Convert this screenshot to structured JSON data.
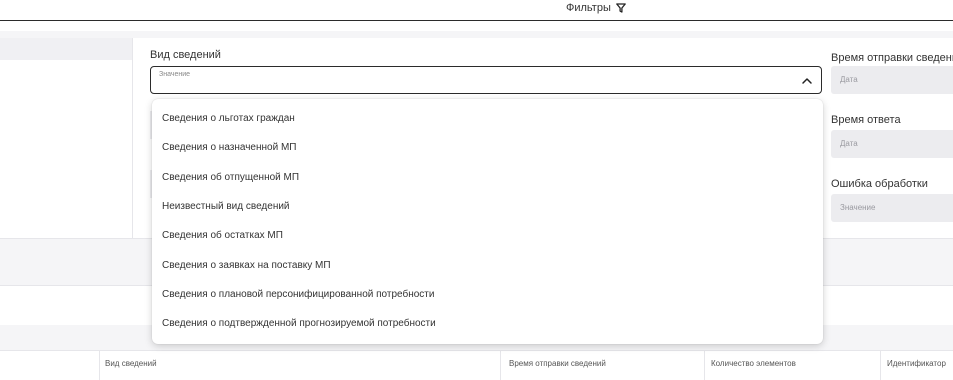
{
  "header": {
    "filters_label": "Фильтры"
  },
  "filters": {
    "kind_label": "Вид сведений",
    "kind_placeholder": "Значение",
    "send_time_label": "Время отправки сведений",
    "send_time_placeholder": "Дата",
    "response_time_label": "Время ответа",
    "response_time_placeholder": "Дата",
    "error_label": "Ошибка обработки",
    "error_placeholder": "Значение"
  },
  "dropdown": {
    "options": [
      "Сведения о льготах граждан",
      "Сведения о назначенной МП",
      "Сведения об отпущенной МП",
      "Неизвестный вид сведений",
      "Сведения об остатках МП",
      "Сведения о заявках на поставку МП",
      "Сведения о плановой персонифицированной потребности",
      "Сведения о подтвержденной прогнозируемой потребности"
    ]
  },
  "table": {
    "columns": [
      "Вид сведений",
      "Время отправки сведений",
      "Количество элементов",
      "Идентификатор"
    ]
  }
}
